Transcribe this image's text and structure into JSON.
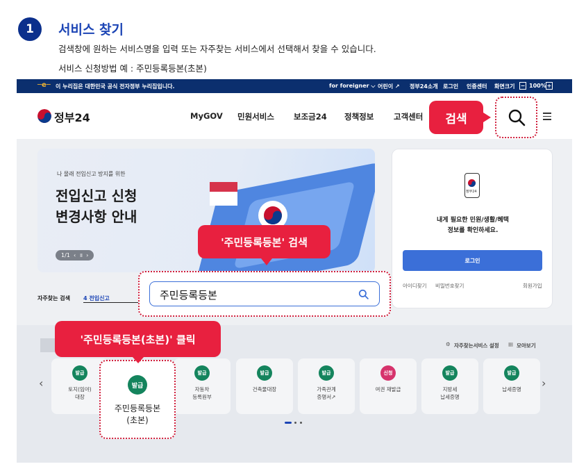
{
  "step": {
    "number": "1",
    "title": "서비스 찾기",
    "desc1": "검색창에 원하는 서비스명을 입력 또는 자주찾는 서비스에서 선택해서 찾을 수 있습니다.",
    "desc2": "서비스 신청방법 예 : 주민등록등본(초본)"
  },
  "govbar": {
    "notice": "이 누리집은 대한민국 공식 전자정부 누리집입니다.",
    "links": [
      "for foreigner ⌵",
      "어린이 ↗",
      "정부24소개",
      "로그인",
      "인증센터"
    ],
    "zoom_label": "화면크기",
    "zoom_minus": "−",
    "zoom_value": "100%",
    "zoom_plus": "+"
  },
  "header": {
    "logo": "정부24",
    "nav": [
      "MyGOV",
      "민원서비스",
      "보조금24",
      "정책정보",
      "고객센터"
    ]
  },
  "banner": {
    "eyebrow": "나 몰래 전입신고 방지를 위한",
    "title1": "전입신고 신청",
    "title2": "변경사항 안내",
    "pager": "1/1  ‹  ॥  ›"
  },
  "login_card": {
    "phone_label": "정부24",
    "line1": "내게 필요한 민원/생활/혜택",
    "line2": "정보를 확인하세요.",
    "login_button": "로그인",
    "find_id": "아이디찾기",
    "find_pw": "비밀번호찾기",
    "signup": "회원가입"
  },
  "frequent": {
    "label": "자주찾는 검색",
    "keyword": "4 전입신고"
  },
  "search": {
    "value": "주민등록등본"
  },
  "services_toolbar": {
    "settings": "자주찾는서비스 설정",
    "view_all": "모아보기"
  },
  "services": [
    {
      "badge": "발급",
      "label": "토지(임야)\n대장"
    },
    {
      "badge": "발급",
      "label": "주민등록등본\n(초본)"
    },
    {
      "badge": "발급",
      "label": "자동차\n등록원부"
    },
    {
      "badge": "발급",
      "label": "건축물대장"
    },
    {
      "badge": "발급",
      "label": "가족관계\n증명서↗"
    },
    {
      "badge": "신청",
      "label": "여권 재발급"
    },
    {
      "badge": "발급",
      "label": "지방세\n납세증명"
    },
    {
      "badge": "발급",
      "label": "납세증명"
    }
  ],
  "callouts": {
    "search": "검색",
    "search_keyword": "'주민등록등본' 검색",
    "click": "'주민등록등본(초본)' 클릭"
  },
  "colors": {
    "accent": "#e8203f",
    "brand_navy": "#0b2f6e",
    "issue_green": "#14845d",
    "apply_pink": "#d6336c",
    "login_blue": "#3b6fd8"
  }
}
